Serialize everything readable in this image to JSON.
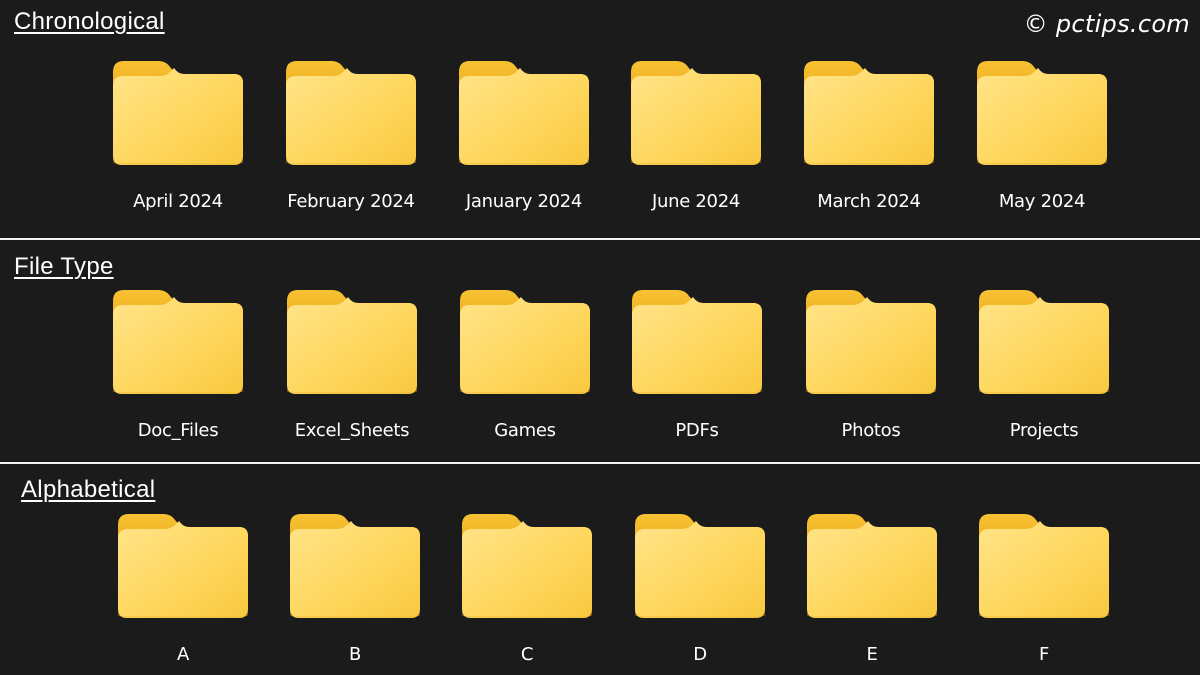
{
  "watermark": "© pctips.com",
  "colors": {
    "background": "#1b1b1b",
    "divider": "#f2f2f2",
    "folder_tab": "#f3b728",
    "folder_body_light": "#ffe48a",
    "folder_body_dark": "#f8c83f"
  },
  "icon": "folder-icon",
  "sections": [
    {
      "title": "Chronological",
      "folders": [
        "April 2024",
        "February 2024",
        "January 2024",
        "June 2024",
        "March 2024",
        "May 2024"
      ]
    },
    {
      "title": "File Type",
      "folders": [
        "Doc_Files",
        "Excel_Sheets",
        "Games",
        "PDFs",
        "Photos",
        "Projects"
      ]
    },
    {
      "title": "Alphabetical",
      "folders": [
        "A",
        "B",
        "C",
        "D",
        "E",
        "F"
      ]
    }
  ]
}
